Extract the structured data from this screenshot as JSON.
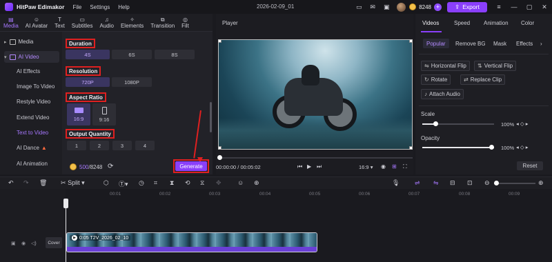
{
  "app": {
    "name": "HitPaw Edimakor",
    "menu": [
      "File",
      "Settings",
      "Help"
    ],
    "doc_title": "2026-02-09_01",
    "credits": "8248",
    "export_label": "Export",
    "accent": "#8a3ffc"
  },
  "tabs": [
    {
      "label": "Media",
      "icon": "media-icon"
    },
    {
      "label": "AI Avatar",
      "icon": "avatar-icon"
    },
    {
      "label": "Text",
      "icon": "text-icon"
    },
    {
      "label": "Subtitles",
      "icon": "subtitles-icon"
    },
    {
      "label": "Audio",
      "icon": "audio-icon"
    },
    {
      "label": "Elements",
      "icon": "elements-icon"
    },
    {
      "label": "Transition",
      "icon": "transition-icon"
    },
    {
      "label": "Filt",
      "icon": "filter-icon"
    }
  ],
  "sidebar": {
    "groups": [
      {
        "label": "Media"
      },
      {
        "label": "AI Video"
      }
    ],
    "items": [
      {
        "label": "AI Effects"
      },
      {
        "label": "Image To Video"
      },
      {
        "label": "Restyle Video"
      },
      {
        "label": "Extend Video"
      },
      {
        "label": "Text to Video"
      },
      {
        "label": "AI Dance"
      },
      {
        "label": "AI Animation"
      }
    ]
  },
  "settings": {
    "duration_label": "Duration",
    "durations": [
      "4S",
      "6S",
      "8S"
    ],
    "resolution_label": "Resolution",
    "resolutions": [
      "720P",
      "1080P"
    ],
    "aspect_label": "Aspect Ratio",
    "aspects": [
      "16:9",
      "9:16"
    ],
    "quantity_label": "Output Quantity",
    "quantities": [
      "1",
      "2",
      "3",
      "4"
    ]
  },
  "generate": {
    "used": "500",
    "total": "/8248",
    "label": "Generate"
  },
  "player": {
    "title": "Player",
    "time_current": "00:00:00",
    "time_total": "/ 00:05:02",
    "ratio": "16:9"
  },
  "right_panel": {
    "tabs": [
      "Videos",
      "Speed",
      "Animation",
      "Color"
    ],
    "subtabs": [
      "Popular",
      "Remove BG",
      "Mask",
      "Effects"
    ],
    "buttons": [
      "Horizontal Flip",
      "Vertical Flip",
      "Rotate",
      "Replace Clip",
      "Attach Audio"
    ],
    "scale_label": "Scale",
    "scale_value": "100%",
    "scale_level": 0.05,
    "opacity_label": "Opacity",
    "opacity_value": "100%",
    "opacity_level": 1.0,
    "reset_label": "Reset"
  },
  "timeline": {
    "split_label": "Split",
    "ticks": [
      "00:01",
      "00:02",
      "00:03",
      "00:04",
      "00:05",
      "00:06",
      "00:07",
      "00:08",
      "00:09"
    ],
    "clip_label": "0:05  T2V_2026_02_10",
    "cover_label": "Cover"
  }
}
